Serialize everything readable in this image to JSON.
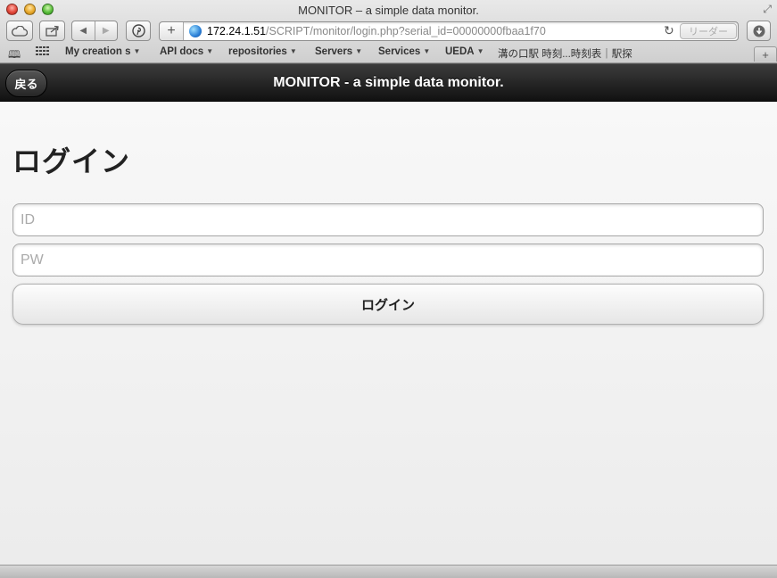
{
  "window": {
    "title": "MONITOR – a simple data monitor."
  },
  "toolbar": {
    "url_host": "172.24.1.51",
    "url_path": "/SCRIPT/monitor/login.php?serial_id=00000000fbaa1f70",
    "reader_label": "リーダー"
  },
  "bookmarks": [
    {
      "label": "My creation s",
      "dropdown": true
    },
    {
      "label": "API docs",
      "dropdown": true
    },
    {
      "label": "repositories",
      "dropdown": true
    },
    {
      "label": "Servers",
      "dropdown": true
    },
    {
      "label": "Services",
      "dropdown": true
    },
    {
      "label": "UEDA",
      "dropdown": true
    },
    {
      "label": "溝の口駅 時刻...時刻表｜駅探",
      "dropdown": false
    }
  ],
  "header": {
    "back_label": "戻る",
    "title": "MONITOR - a simple data monitor."
  },
  "login": {
    "heading": "ログイン",
    "id_placeholder": "ID",
    "pw_placeholder": "PW",
    "submit_label": "ログイン"
  }
}
